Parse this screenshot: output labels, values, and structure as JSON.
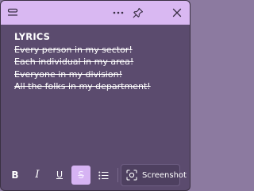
{
  "titlebar": {
    "icons": [
      "menu-icon",
      "more-icon",
      "pin-icon",
      "close-icon"
    ]
  },
  "note": {
    "title": "LYRICS",
    "lines": [
      "Every person in my sector!",
      "Each individual in my area!",
      "Everyone in my division!",
      "All the folks in my department!"
    ]
  },
  "toolbar": {
    "bold": "B",
    "italic": "I",
    "underline": "U",
    "strikethrough": "S",
    "screenshot_label": "Screenshot",
    "active_format": "strikethrough"
  },
  "colors": {
    "background": "#5b4b6e",
    "titlebar": "#d9b8f2",
    "accent": "#d6b3f3",
    "text": "#ffffff"
  }
}
